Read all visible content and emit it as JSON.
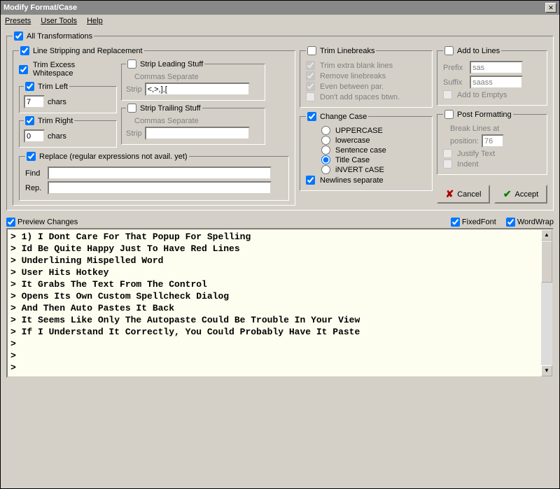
{
  "window": {
    "title": "Modify Format/Case"
  },
  "menu": {
    "presets": "Presets",
    "userTools": "User Tools",
    "help": "Help"
  },
  "allTrans": {
    "label": "All Transformations"
  },
  "lineStrip": {
    "label": "Line Stripping and Replacement",
    "trimExcess": "Trim Excess Whitespace",
    "trimLeft": "Trim Left",
    "trimLeftVal": "7",
    "trimRight": "Trim Right",
    "trimRightVal": "0",
    "charsLabel": "chars",
    "stripLeading": "Strip Leading Stuff",
    "stripTrailing": "Strip Trailing Stuff",
    "commasSep": "Commas Separate",
    "stripLabel": "Strip",
    "stripLeadingVal": "<,>,],[",
    "stripTrailingVal": ""
  },
  "replace": {
    "label": "Replace (regular expressions not avail. yet)",
    "findLabel": "Find",
    "repLabel": "Rep.",
    "findVal": "",
    "repVal": ""
  },
  "trimLB": {
    "label": "Trim Linebreaks",
    "extra": "Trim extra blank lines",
    "remove": "Remove linebreaks",
    "evenPar": "Even between par.",
    "dontAdd": "Don't add spaces btwn."
  },
  "changeCase": {
    "label": "Change Case",
    "upper": "UPPERCASE",
    "lower": "lowercase",
    "sentence": "Sentence case",
    "title": "Title Case",
    "invert": "iNVERT cASE",
    "newlines": "Newlines separate"
  },
  "addLines": {
    "label": "Add to Lines",
    "prefixLabel": "Prefix",
    "prefixVal": "sas",
    "suffixLabel": "Suffix",
    "suffixVal": "saass",
    "addEmptys": "Add to Emptys"
  },
  "postFmt": {
    "label": "Post Formatting",
    "breakLines": "Break Lines at",
    "posLabel": "position:",
    "posVal": "76",
    "justify": "Justify Text",
    "indent": "Indent"
  },
  "buttons": {
    "cancel": "Cancel",
    "accept": "Accept"
  },
  "previewBar": {
    "preview": "Preview Changes",
    "fixedFont": "FixedFont",
    "wordWrap": "WordWrap"
  },
  "previewLines": [
    "> 1) I Dont Care For That Popup For Spelling",
    "> Id Be Quite Happy Just To Have Red Lines",
    "> Underlining Mispelled Word",
    "> User Hits Hotkey",
    "> It Grabs The Text From The Control",
    "> Opens Its Own Custom Spellcheck Dialog",
    "> And Then Auto Pastes It Back",
    "> It Seems Like Only The Autopaste Could Be Trouble In Your View",
    "> If I Understand It Correctly, You Could Probably Have It Paste",
    ">",
    ">",
    ">"
  ]
}
